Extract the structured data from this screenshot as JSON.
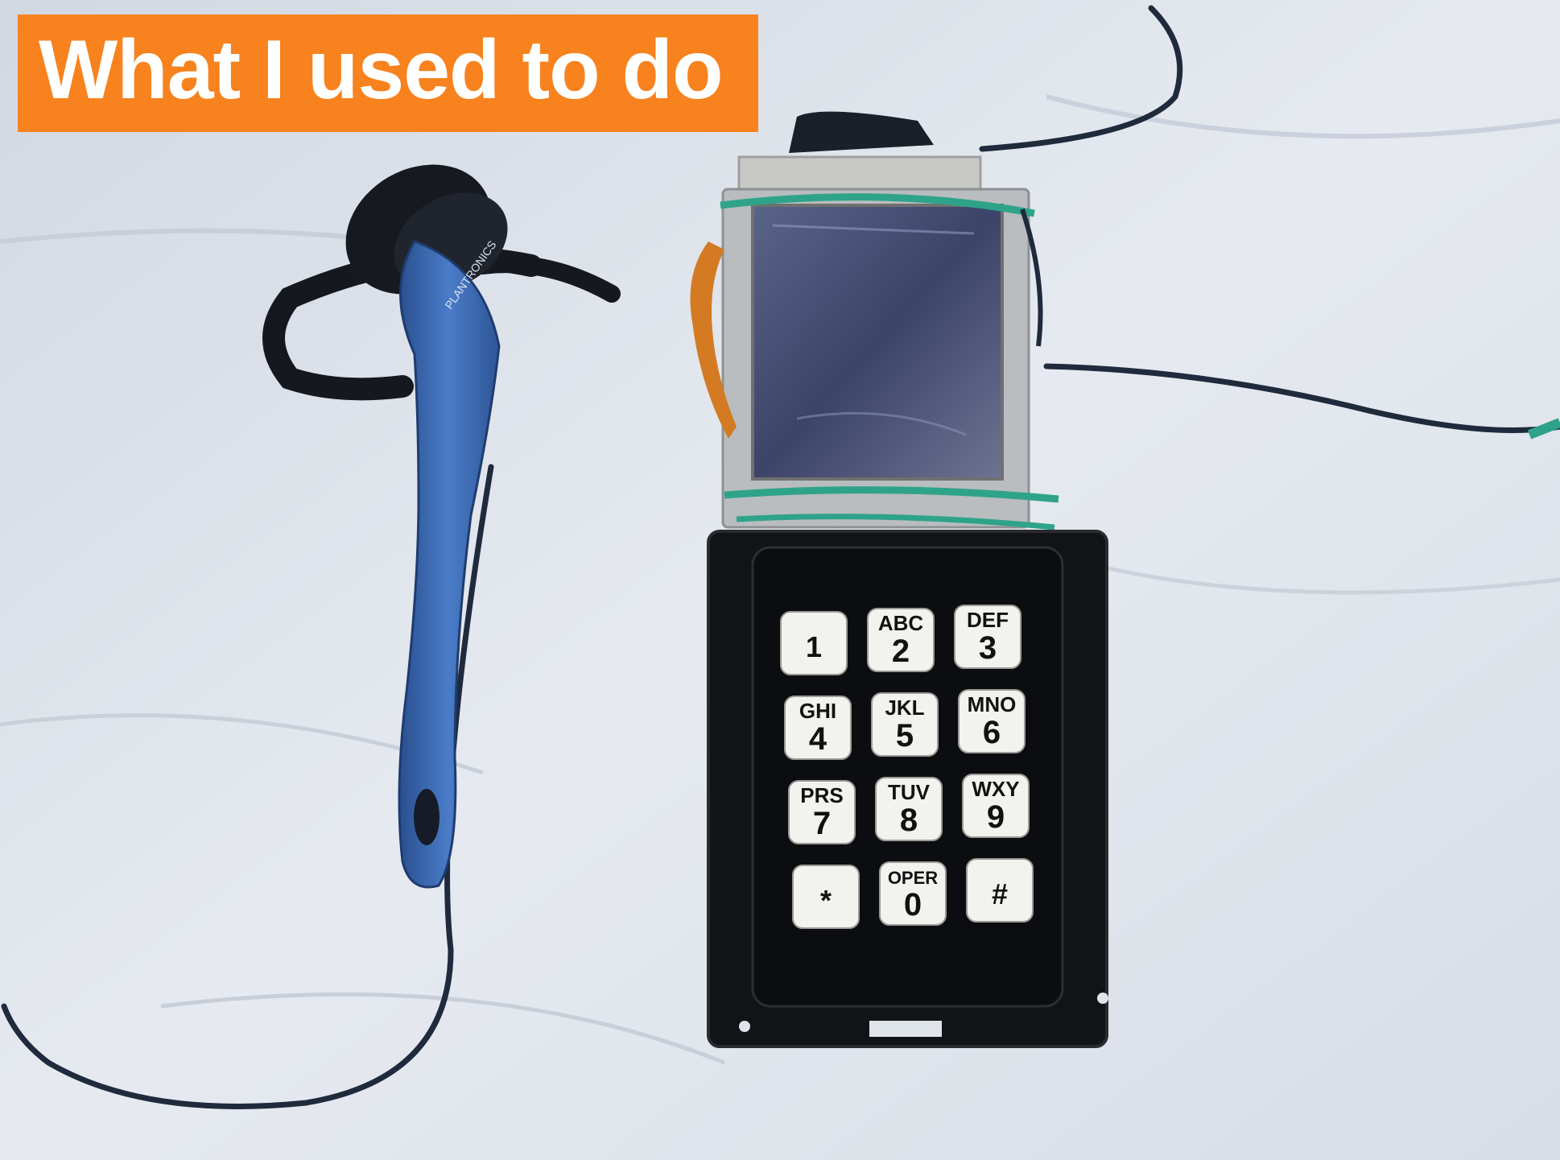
{
  "slide": {
    "title": "What I used to do",
    "title_bg_color": "#f7821e",
    "title_text_color": "#ffffff"
  },
  "photo": {
    "headset_brand": "PLANTRONICS",
    "keypad": {
      "keys": [
        {
          "letters": "",
          "digit": "1"
        },
        {
          "letters": "ABC",
          "digit": "2"
        },
        {
          "letters": "DEF",
          "digit": "3"
        },
        {
          "letters": "GHI",
          "digit": "4"
        },
        {
          "letters": "JKL",
          "digit": "5"
        },
        {
          "letters": "MNO",
          "digit": "6"
        },
        {
          "letters": "PRS",
          "digit": "7"
        },
        {
          "letters": "TUV",
          "digit": "8"
        },
        {
          "letters": "WXY",
          "digit": "9"
        },
        {
          "letters": "",
          "digit": "*"
        },
        {
          "letters": "OPER",
          "digit": "0"
        },
        {
          "letters": "",
          "digit": "#"
        }
      ]
    },
    "colors": {
      "cloth": "#dde2ea",
      "headset_blue": "#3f6fb8",
      "keypad_black": "#111111",
      "key_white": "#f2f2ee",
      "band_green": "#2fa38a"
    }
  }
}
